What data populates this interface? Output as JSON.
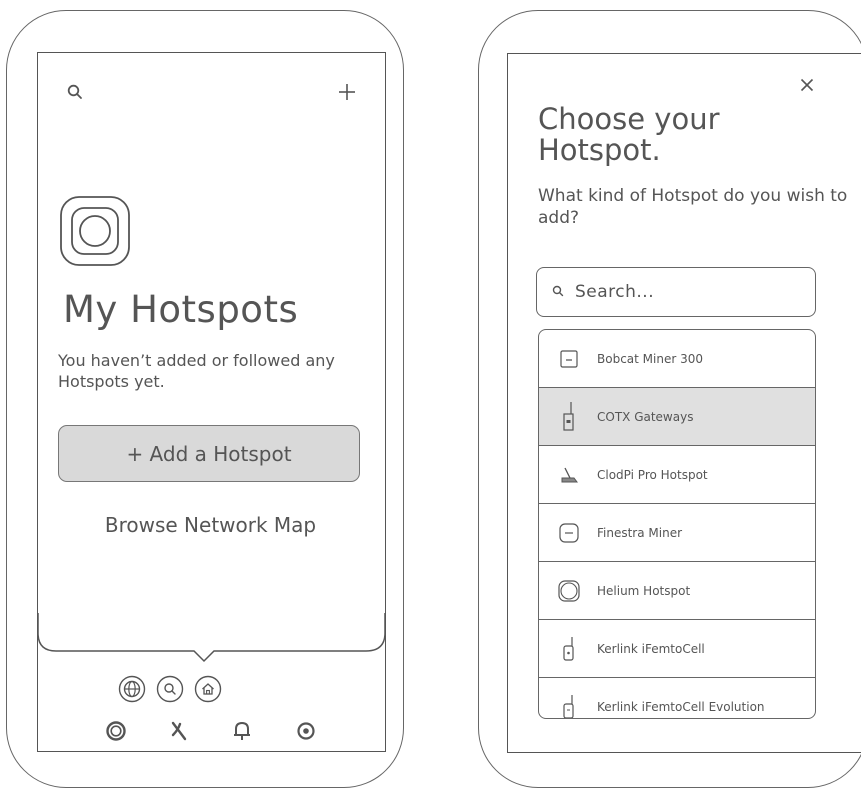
{
  "left_screen": {
    "title": "My Hotspots",
    "subtitle": "You haven’t added or followed any Hotspots yet.",
    "add_button_label": "+ Add a Hotspot",
    "browse_link_label": "Browse Network Map",
    "top_icons": [
      "search-icon",
      "plus-icon"
    ],
    "hotspot_icon": "hotspot-device-icon",
    "quick_actions": [
      "globe-icon",
      "search-icon",
      "home-icon"
    ],
    "tab_bar": [
      "hotspot-tab-icon",
      "explorer-tab-icon",
      "notifications-tab-icon",
      "settings-tab-icon"
    ]
  },
  "right_screen": {
    "title": "Choose your Hotspot.",
    "subtitle": "What kind of Hotspot do you wish to add?",
    "search_placeholder": "Search...",
    "close_icon": "close-icon",
    "hotspot_types": [
      {
        "label": "Bobcat Miner 300",
        "icon": "bobcat-miner-icon",
        "selected": false
      },
      {
        "label": "COTX Gateways",
        "icon": "cotx-gateway-icon",
        "selected": true
      },
      {
        "label": "ClodPi Pro Hotspot",
        "icon": "clodpi-antenna-icon",
        "selected": false
      },
      {
        "label": "Finestra Miner",
        "icon": "finestra-miner-icon",
        "selected": false
      },
      {
        "label": "Helium Hotspot",
        "icon": "helium-hotspot-icon",
        "selected": false
      },
      {
        "label": "Kerlink iFemtoCell",
        "icon": "kerlink-femtocell-icon",
        "selected": false
      },
      {
        "label": "Kerlink iFemtoCell Evolution",
        "icon": "kerlink-femtocell-evolution-icon",
        "selected": false
      }
    ]
  }
}
